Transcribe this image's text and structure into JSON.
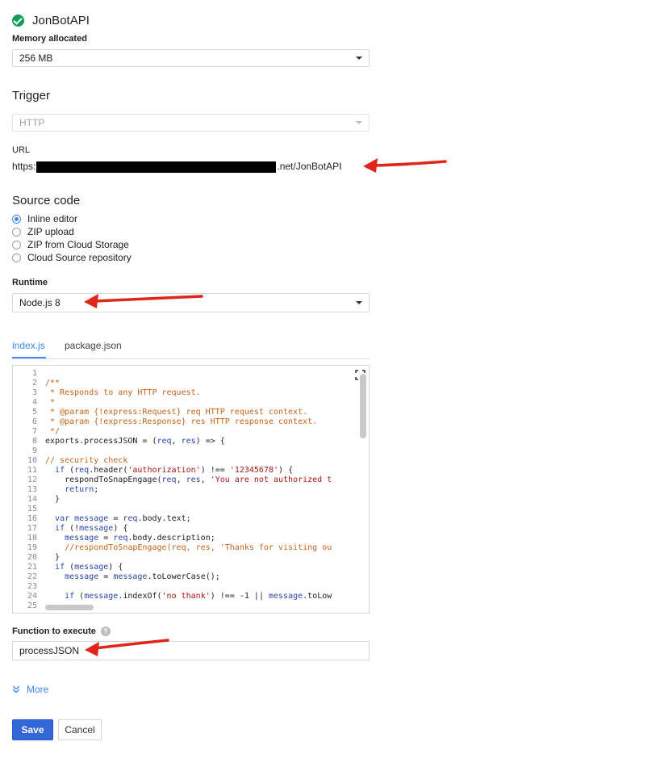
{
  "function": {
    "name": "JonBotAPI",
    "status_color": "#0f9d58"
  },
  "memory": {
    "label": "Memory allocated",
    "value": "256 MB"
  },
  "trigger": {
    "section": "Trigger",
    "value": "HTTP"
  },
  "url": {
    "label": "URL",
    "prefix": "https:",
    "suffix": ".net/JonBotAPI"
  },
  "source": {
    "section": "Source code",
    "options": [
      "Inline editor",
      "ZIP upload",
      "ZIP from Cloud Storage",
      "Cloud Source repository"
    ],
    "selected": "Inline editor"
  },
  "runtime": {
    "label": "Runtime",
    "value": "Node.js 8"
  },
  "editor": {
    "tabs": [
      "index.js",
      "package.json"
    ],
    "active_tab": "index.js",
    "line_numbers": [
      "1",
      "2",
      "3",
      "4",
      "5",
      "6",
      "7",
      "8",
      "9",
      "10",
      "11",
      "12",
      "13",
      "14",
      "15",
      "16",
      "17",
      "18",
      "19",
      "20",
      "21",
      "22",
      "23",
      "24",
      "25"
    ],
    "lines": [
      "",
      "/**",
      " * Responds to any HTTP request.",
      " *",
      " * @param {!express:Request} req HTTP request context.",
      " * @param {!express:Response} res HTTP response context.",
      " */",
      "exports.processJSON = (req, res) => {",
      "",
      "// security check",
      "  if (req.header('authorization') !== '12345678') {",
      "    respondToSnapEngage(req, res, 'You are not authorized t",
      "    return;",
      "  }",
      "",
      "  var message = req.body.text;",
      "  if (!message) {",
      "    message = req.body.description;",
      "    //respondToSnapEngage(req, res, 'Thanks for visiting ou",
      "  }",
      "  if (message) {",
      "    message = message.toLowerCase();",
      "",
      "    if (message.indexOf('no thank') !== -1 || message.toLow",
      ""
    ]
  },
  "function_to_execute": {
    "label": "Function to execute",
    "help": "?",
    "value": "processJSON"
  },
  "more": {
    "label": "More"
  },
  "actions": {
    "save": "Save",
    "cancel": "Cancel"
  },
  "colors": {
    "accent": "#4285f4",
    "primary_button": "#3367d6",
    "annotation_arrow": "#e0261b"
  }
}
